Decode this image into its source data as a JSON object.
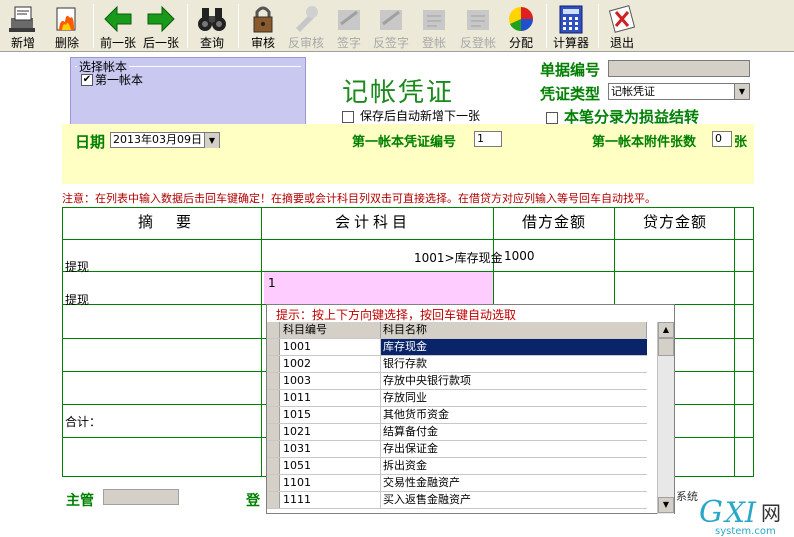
{
  "toolbar": {
    "buttons": [
      {
        "label": "新增",
        "icon": "new-doc-icon",
        "enabled": true
      },
      {
        "label": "删除",
        "icon": "delete-fire-icon",
        "enabled": true
      },
      {
        "label": "前一张",
        "icon": "arrow-left-icon",
        "enabled": true
      },
      {
        "label": "后一张",
        "icon": "arrow-right-icon",
        "enabled": true
      },
      {
        "label": "查询",
        "icon": "binoculars-icon",
        "enabled": true
      },
      {
        "label": "审核",
        "icon": "lock-icon",
        "enabled": true
      },
      {
        "label": "反审核",
        "icon": "unaudit-icon",
        "enabled": false
      },
      {
        "label": "签字",
        "icon": "sign-icon",
        "enabled": false
      },
      {
        "label": "反签字",
        "icon": "unsign-icon",
        "enabled": false
      },
      {
        "label": "登帐",
        "icon": "post-icon",
        "enabled": false
      },
      {
        "label": "反登帐",
        "icon": "unpost-icon",
        "enabled": false
      },
      {
        "label": "分配",
        "icon": "pie-chart-icon",
        "enabled": true
      },
      {
        "label": "计算器",
        "icon": "calculator-icon",
        "enabled": true
      },
      {
        "label": "退出",
        "icon": "exit-icon",
        "enabled": true
      }
    ]
  },
  "account_select": {
    "legend": "选择帐本",
    "items": [
      {
        "label": "第一帐本",
        "checked": true
      }
    ]
  },
  "header": {
    "title": "记帐凭证",
    "auto_new_label": "保存后自动新增下一张",
    "doc_no_label": "单据编号",
    "doc_no_value": "",
    "voucher_type_label": "凭证类型",
    "voucher_type_value": "记帐凭证",
    "carry_over_label": "本笔分录为损益结转"
  },
  "date_bar": {
    "date_label": "日期",
    "date_value": "2013年03月09日",
    "voucher_no_label": "第一帐本凭证编号",
    "voucher_no_value": "1",
    "attachments_label": "第一帐本附件张数",
    "attachments_value": "0",
    "attachments_unit": "张"
  },
  "notice": "注意：在列表中输入数据后击回车键确定！在摘要或会计科目列双击可直接选择。在借贷方对应列输入等号回车自动找平。",
  "entry_table": {
    "headers": [
      "摘　要",
      "会计科目",
      "借方金额",
      "贷方金额"
    ],
    "rows": [
      {
        "summary": "提现",
        "account": "1001>库存现金",
        "debit": "1000",
        "credit": ""
      },
      {
        "summary": "提现",
        "account": "1",
        "debit": "",
        "credit": ""
      }
    ],
    "total_label": "合计："
  },
  "account_popup": {
    "hint": "提示：按上下方向键选择，按回车键自动选取",
    "columns": [
      "科目编号",
      "科目名称"
    ],
    "rows": [
      {
        "code": "1001",
        "name": "库存现金",
        "selected": true
      },
      {
        "code": "1002",
        "name": "银行存款"
      },
      {
        "code": "1003",
        "name": "存放中央银行款项"
      },
      {
        "code": "1011",
        "name": "存放同业"
      },
      {
        "code": "1015",
        "name": "其他货币资金"
      },
      {
        "code": "1021",
        "name": "结算备付金"
      },
      {
        "code": "1031",
        "name": "存出保证金"
      },
      {
        "code": "1051",
        "name": "拆出资金"
      },
      {
        "code": "1101",
        "name": "交易性金融资产"
      },
      {
        "code": "1111",
        "name": "买入返售金融资产"
      }
    ]
  },
  "footer": {
    "supervisor_label": "主管",
    "poster_label": "登",
    "system_fragment": "系统"
  },
  "watermark": {
    "brand": "GXI网",
    "domain": "system.com"
  },
  "colors": {
    "title_green": "#1a8a1a",
    "label_green": "#008000",
    "notice_red": "#b00000",
    "account_box": "#c8c8f0",
    "yellow_band": "#ffffc4",
    "pink_cell": "#ffccff",
    "selection": "#0a246a"
  }
}
